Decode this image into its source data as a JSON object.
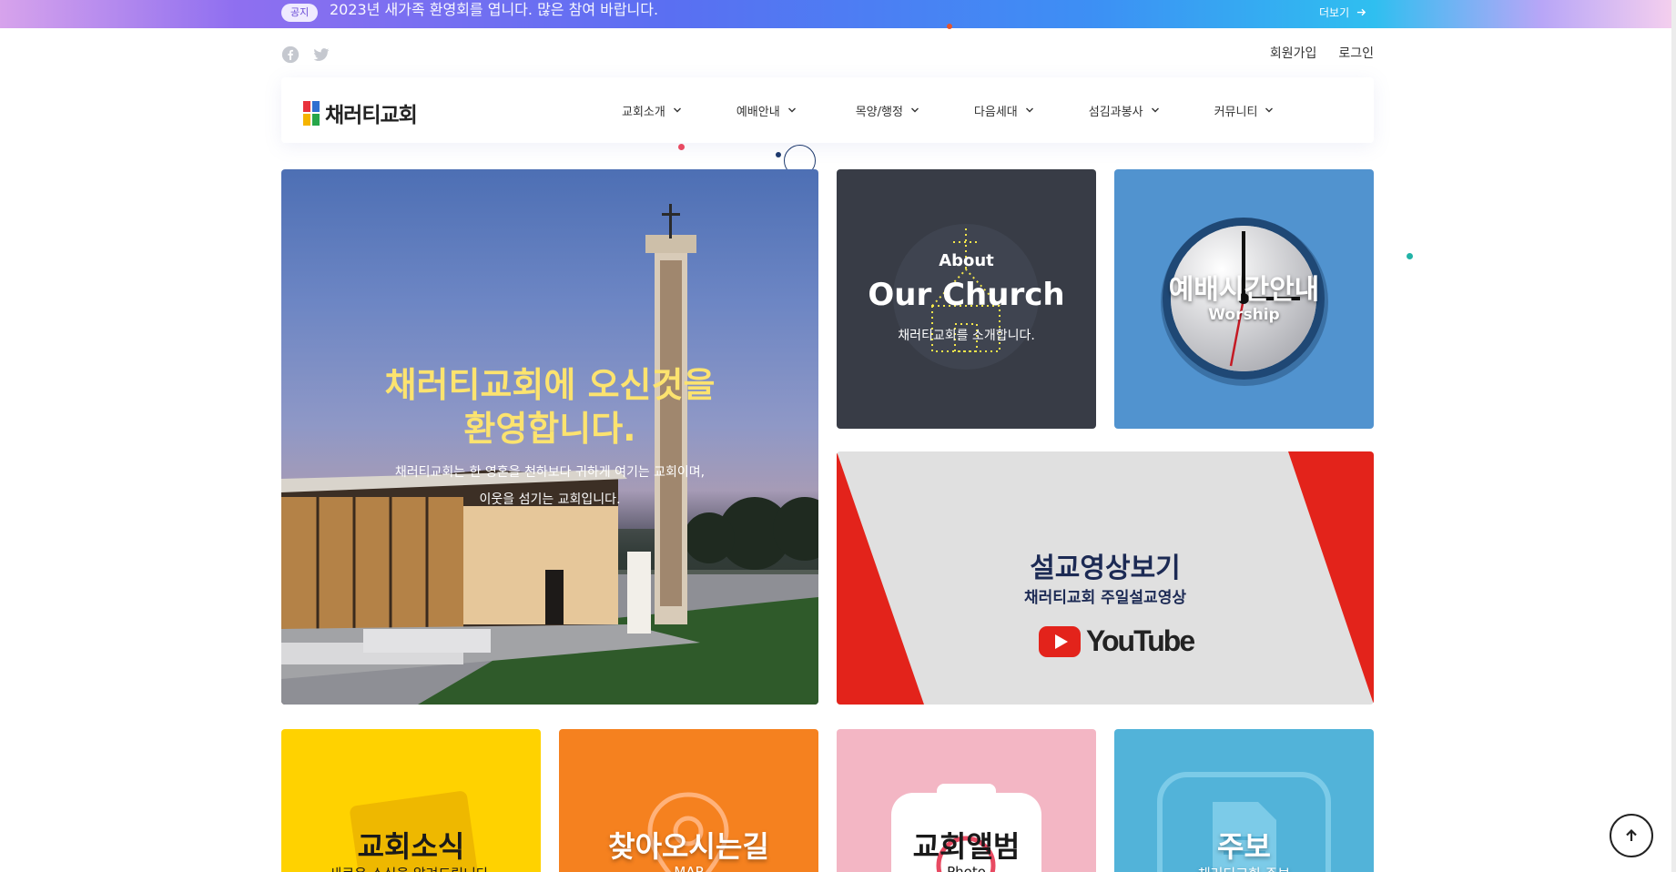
{
  "notice": {
    "badge": "공지",
    "text": "2023년 새가족 환영회를 엽니다. 많은 참여 바랍니다.",
    "more_label": "더보기"
  },
  "sns": {
    "facebook_icon": "facebook-icon",
    "twitter_icon": "twitter-icon"
  },
  "util": {
    "signup": "회원가입",
    "login": "로그인"
  },
  "logo": {
    "text": "채러티교회",
    "colors": [
      "#e8323c",
      "#2f6fd0",
      "#f5b400",
      "#27a64a"
    ]
  },
  "menu": {
    "items": [
      "교회소개",
      "예배안내",
      "목양/행정",
      "다음세대",
      "섬김과봉사",
      "커뮤니티"
    ]
  },
  "hero": {
    "title_line1": "채러티교회에 오신것을",
    "title_line2": "환영합니다.",
    "sub_line1": "채러티교회는 한 영혼을 천하보다 귀하게 여기는 교회이며,",
    "sub_line2": "이웃을 섬기는 교회입니다."
  },
  "about": {
    "label_small": "About",
    "label_big": "Our Church",
    "desc": "채러티교회를 소개합니다."
  },
  "worship": {
    "title": "예배시간안내",
    "sub": "Worship"
  },
  "sermon": {
    "title": "설교영상보기",
    "sub": "채러티교회 주일설교영상",
    "brand": "YouTube",
    "accent": "#e3231b"
  },
  "tiles": [
    {
      "title": "교회소식",
      "sub": "새로운 소식을 알려드립니다.",
      "color": "#ffd200"
    },
    {
      "title": "찾아오시는길",
      "sub": "MAP",
      "color": "#f5811f"
    },
    {
      "title": "교회앨범",
      "sub": "Photo",
      "color": "#f3b6c4"
    },
    {
      "title": "주보",
      "sub": "채러티교회 주보",
      "color": "#52b3d9"
    }
  ]
}
